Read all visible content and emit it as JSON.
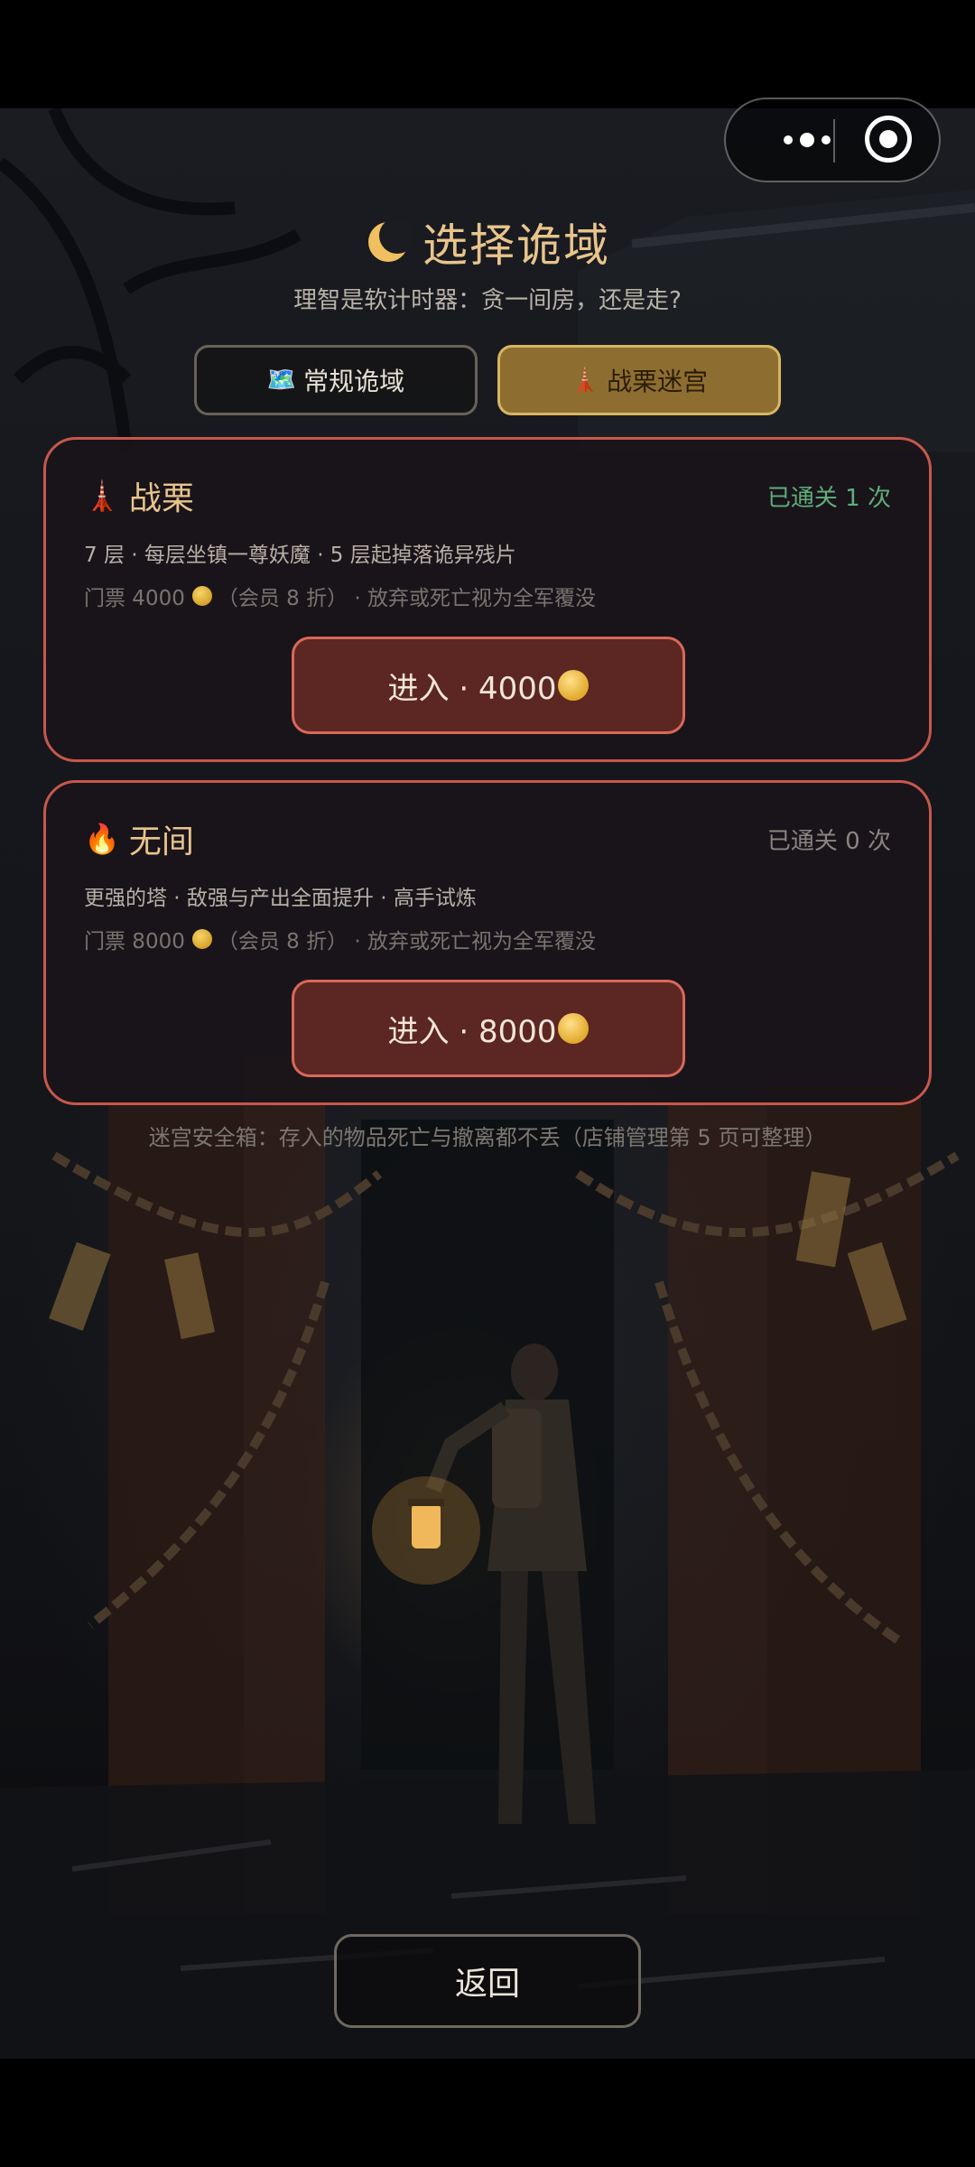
{
  "header": {
    "moon_icon": "crescent-moon-icon",
    "title": "选择诡域",
    "subtitle": "理智是软计时器：贪一间房，还是走?"
  },
  "capsule": {
    "more_icon": "more-dots-icon",
    "close_icon": "target-circle-icon"
  },
  "tabs": [
    {
      "icon": "🗺️",
      "label": "常规诡域",
      "selected": false
    },
    {
      "icon": "🗼",
      "label": "战栗迷宫",
      "selected": true
    }
  ],
  "cards": [
    {
      "icon": "🗼",
      "name": "战栗",
      "cleared": "已通关 1 次",
      "desc": "7 层 · 每层坐镇一尊妖魔 · 5 层起掉落诡异残片",
      "ticket_prefix": "门票 4000",
      "ticket_suffix": "（会员 8 折） · 放弃或死亡视为全军覆没",
      "enter_label": "进入 · 4000"
    },
    {
      "icon": "🔥",
      "name": "无间",
      "cleared": "已通关 0 次",
      "desc": "更强的塔 · 敌强与产出全面提升 · 高手试炼",
      "ticket_prefix": "门票 8000",
      "ticket_suffix": "（会员 8 折） · 放弃或死亡视为全军覆没",
      "enter_label": "进入 · 8000"
    }
  ],
  "note": "迷宫安全箱：存入的物品死亡与撤离都不丢（店铺管理第 5 页可整理）",
  "back_label": "返回",
  "colors": {
    "accent_gold": "#e8c48c",
    "card_border": "#c8574c",
    "cleared_green": "#5fae7c",
    "tab_selected": "#8e6e30"
  }
}
